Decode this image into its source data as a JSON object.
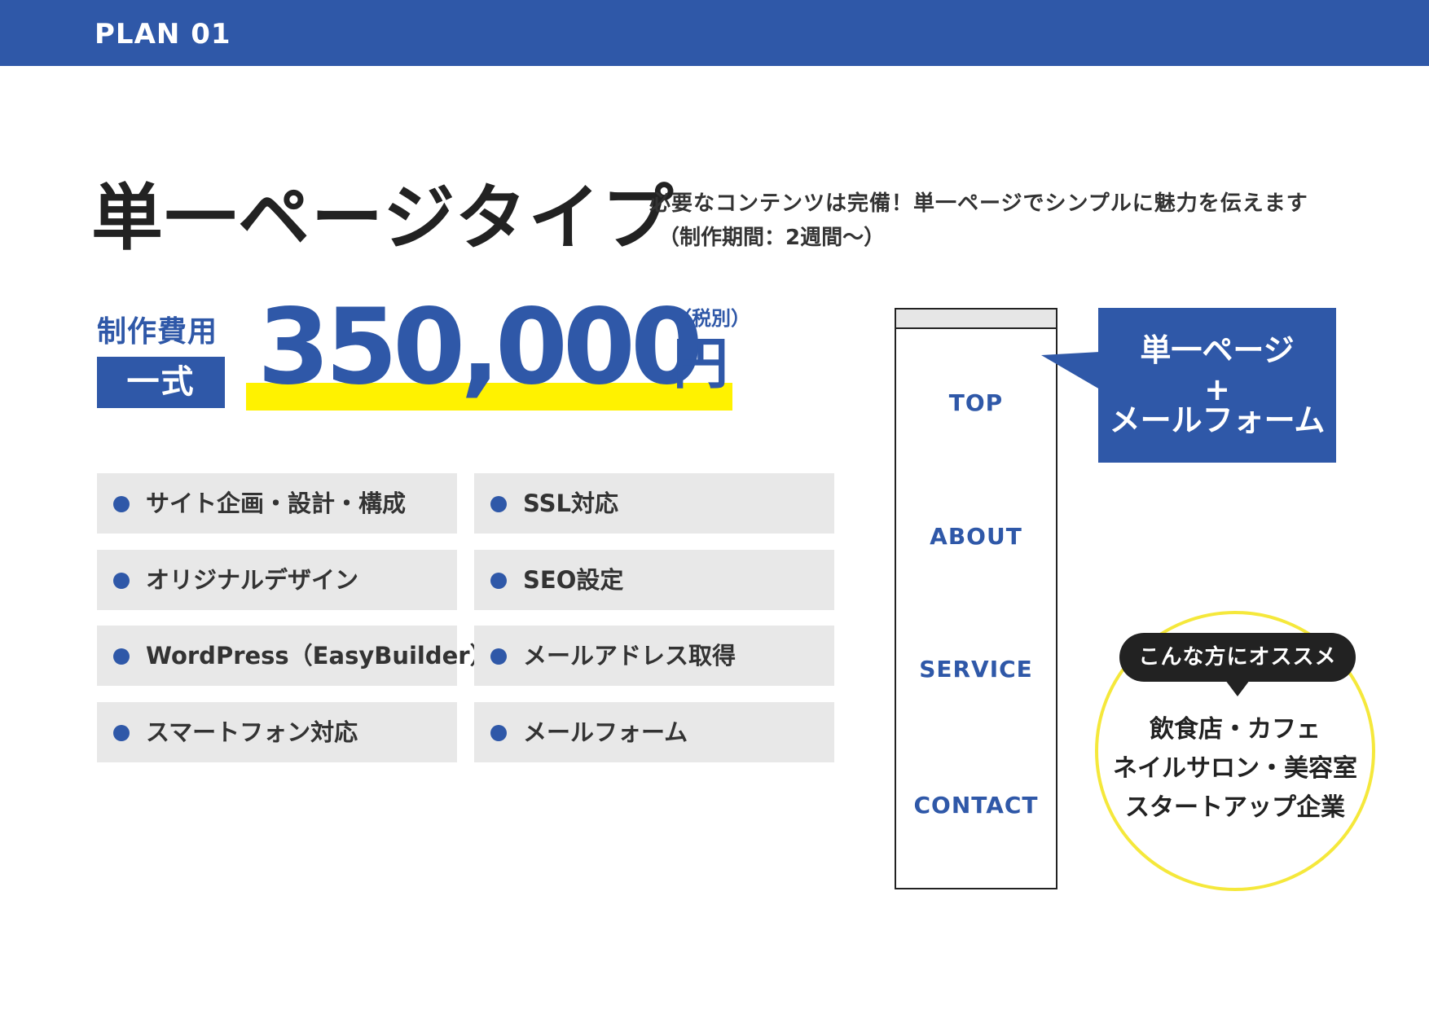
{
  "header": {
    "plan_label": "PLAN 01"
  },
  "title": "単一ページタイプ",
  "tagline": "必要なコンテンツは完備！単一ページでシンプルに魅力を伝えます",
  "period": "（制作期間：2週間〜）",
  "pricing": {
    "label": "制作費用",
    "badge": "一式",
    "amount": "350,000",
    "tax_note": "（税別）",
    "currency": "円"
  },
  "features": [
    "サイト企画・設計・構成",
    "SSL対応",
    "オリジナルデザイン",
    "SEO設定",
    "WordPress（EasyBuilder）",
    "メールアドレス取得",
    "スマートフォン対応",
    "メールフォーム"
  ],
  "mockup": {
    "nav": [
      "TOP",
      "ABOUT",
      "SERVICE",
      "CONTACT"
    ]
  },
  "callout": {
    "lines": [
      "単一ページ",
      "+",
      "メールフォーム"
    ]
  },
  "recommend": {
    "heading": "こんな方にオススメ",
    "lines": [
      "飲食店・カフェ",
      "ネイルサロン・美容室",
      "スタートアップ企業"
    ]
  },
  "colors": {
    "primary": "#2f58a8",
    "highlight": "#fff200",
    "circle": "#f5e83b",
    "feature_bg": "#e8e8e8"
  }
}
